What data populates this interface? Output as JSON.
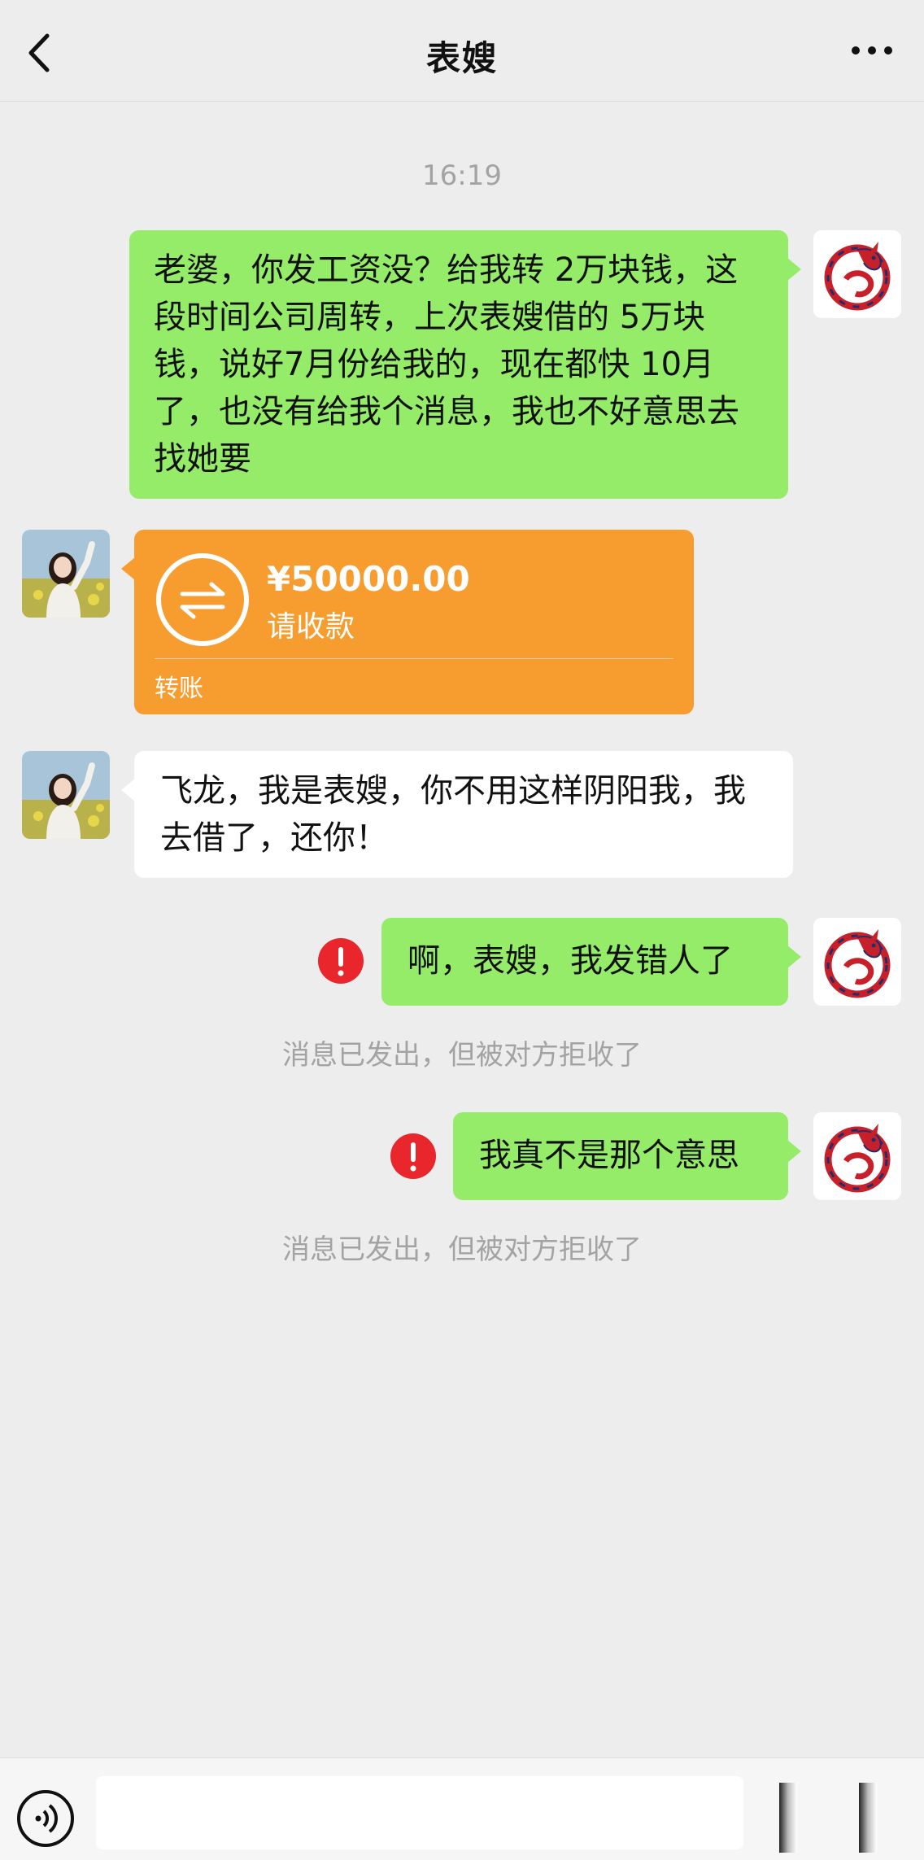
{
  "header": {
    "title": "表嫂"
  },
  "chat": {
    "timestamp": "16:19",
    "messages": [
      {
        "sender": "me",
        "type": "text",
        "text": "老婆，你发工资没？给我转 2万块钱，这段时间公司周转，上次表嫂借的 5万块钱，说好7月份给我的，现在都快 10月了，也没有给我个消息，我也不好意思去找她要"
      },
      {
        "sender": "other",
        "type": "transfer",
        "amount": "¥50000.00",
        "status": "请收款",
        "label": "转账"
      },
      {
        "sender": "other",
        "type": "text",
        "text": "飞龙，我是表嫂，你不用这样阴阳我，我去借了，还你！"
      },
      {
        "sender": "me",
        "type": "text",
        "text": "啊，表嫂，我发错人了",
        "failed": true,
        "notice": "消息已发出，但被对方拒收了"
      },
      {
        "sender": "me",
        "type": "text",
        "text": "我真不是那个意思",
        "failed": true,
        "notice": "消息已发出，但被对方拒收了"
      }
    ]
  },
  "colors": {
    "my_bubble": "#95ec69",
    "their_bubble": "#ffffff",
    "transfer_card": "#f79c2f",
    "alert": "#e8262b",
    "background": "#ededed"
  },
  "icons": [
    "back-arrow-icon",
    "more-icon",
    "transfer-arrows-icon",
    "alert-icon",
    "voice-icon",
    "dragon-avatar",
    "girl-avatar"
  ]
}
